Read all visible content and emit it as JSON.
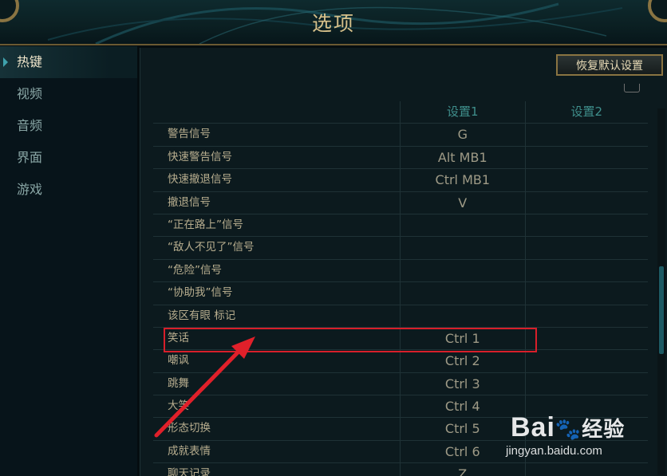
{
  "window": {
    "title": "选项"
  },
  "sidebar": {
    "items": [
      {
        "label": "热键",
        "active": true
      },
      {
        "label": "视频",
        "active": false
      },
      {
        "label": "音频",
        "active": false
      },
      {
        "label": "界面",
        "active": false
      },
      {
        "label": "游戏",
        "active": false
      }
    ]
  },
  "toolbar": {
    "reset_label": "恢复默认设置"
  },
  "table": {
    "headers": [
      "",
      "设置1",
      "设置2"
    ],
    "rows": [
      {
        "action": "警告信号",
        "key1": "G",
        "key2": ""
      },
      {
        "action": "快速警告信号",
        "key1": "Alt  MB1",
        "key2": ""
      },
      {
        "action": "快速撤退信号",
        "key1": "Ctrl  MB1",
        "key2": ""
      },
      {
        "action": "撤退信号",
        "key1": "V",
        "key2": ""
      },
      {
        "action": "“正在路上”信号",
        "key1": "",
        "key2": ""
      },
      {
        "action": "“敌人不见了”信号",
        "key1": "",
        "key2": ""
      },
      {
        "action": "“危险”信号",
        "key1": "",
        "key2": ""
      },
      {
        "action": "“协助我”信号",
        "key1": "",
        "key2": ""
      },
      {
        "action": "该区有眼 标记",
        "key1": "",
        "key2": ""
      },
      {
        "action": "笑话",
        "key1": "Ctrl  1",
        "key2": ""
      },
      {
        "action": "嘲讽",
        "key1": "Ctrl  2",
        "key2": ""
      },
      {
        "action": "跳舞",
        "key1": "Ctrl  3",
        "key2": ""
      },
      {
        "action": "大笑",
        "key1": "Ctrl  4",
        "key2": ""
      },
      {
        "action": "形态切换",
        "key1": "Ctrl  5",
        "key2": ""
      },
      {
        "action": "成就表情",
        "key1": "Ctrl  6",
        "key2": ""
      },
      {
        "action": "聊天记录",
        "key1": "Z",
        "key2": ""
      }
    ]
  },
  "annotation": {
    "highlight_color": "#d81f2a",
    "arrow_color": "#e0202a"
  },
  "watermark": {
    "brand": "Bai",
    "brand_suffix": "经验",
    "url": "jingyan.baidu.com"
  },
  "colors": {
    "accent": "#3fa2ad",
    "gold": "#8a7442"
  }
}
